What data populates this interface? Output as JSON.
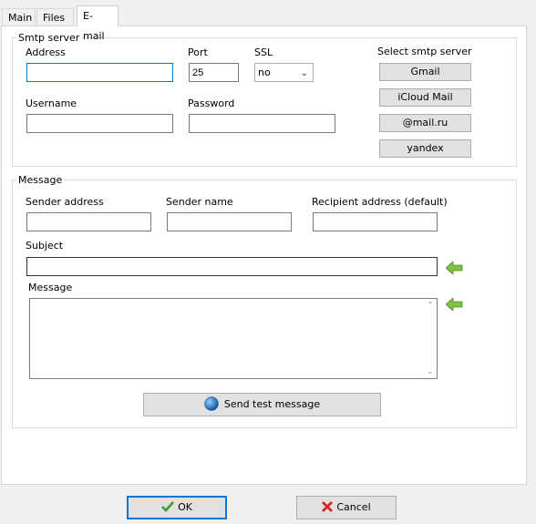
{
  "tabs": [
    "Main",
    "Files",
    "E-mail"
  ],
  "smtp": {
    "legend": "Smtp server",
    "address_label": "Address",
    "address_value": "",
    "port_label": "Port",
    "port_value": "25",
    "ssl_label": "SSL",
    "ssl_value": "no",
    "username_label": "Username",
    "username_value": "",
    "password_label": "Password",
    "password_value": "",
    "select_label": "Select smtp server",
    "presets": [
      "Gmail",
      "iCloud Mail",
      "@mail.ru",
      "yandex"
    ]
  },
  "message": {
    "legend": "Message",
    "sender_address_label": "Sender address",
    "sender_name_label": "Sender name",
    "recipient_label": "Recipient address (default)",
    "subject_label": "Subject",
    "message_label": "Message",
    "send_test_label": "Send test message"
  },
  "footer": {
    "ok_label": "OK",
    "cancel_label": "Cancel"
  },
  "colors": {
    "accent": "#0078d7",
    "arrow": "#7cc142",
    "cancel_x": "#d9262b",
    "ok_check": "#3c9e2e"
  }
}
